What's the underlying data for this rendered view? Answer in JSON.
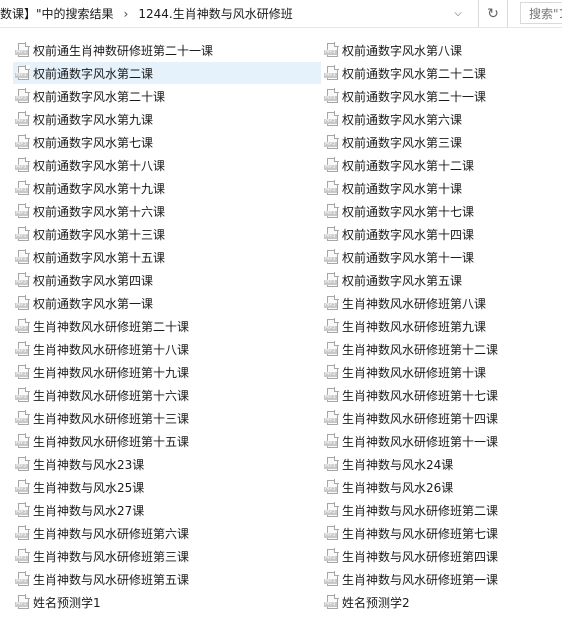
{
  "topbar": {
    "breadcrumb_part1": "数课】\"中的搜索结果",
    "separator": "›",
    "breadcrumb_part2": "1244.生肖神数与风水研修班",
    "dropdown_glyph": "⌵",
    "refresh_glyph": "↻",
    "search_placeholder": "搜索\"1"
  },
  "file_icon_tag": "MP3",
  "files_left": [
    "权前通生肖神数研修班第二十一课",
    "权前通数字风水第二课",
    "权前通数字风水第二十课",
    "权前通数字风水第九课",
    "权前通数字风水第七课",
    "权前通数字风水第十八课",
    "权前通数字风水第十九课",
    "权前通数字风水第十六课",
    "权前通数字风水第十三课",
    "权前通数字风水第十五课",
    "权前通数字风水第四课",
    "权前通数字风水第一课",
    "生肖神数风水研修班第二十课",
    "生肖神数风水研修班第十八课",
    "生肖神数风水研修班第十九课",
    "生肖神数风水研修班第十六课",
    "生肖神数风水研修班第十三课",
    "生肖神数风水研修班第十五课",
    "生肖神数与风水23课",
    "生肖神数与风水25课",
    "生肖神数与风水27课",
    "生肖神数与风水研修班第六课",
    "生肖神数与风水研修班第三课",
    "生肖神数与风水研修班第五课",
    "姓名预测学1"
  ],
  "files_right": [
    "权前通数字风水第八课",
    "权前通数字风水第二十二课",
    "权前通数字风水第二十一课",
    "权前通数字风水第六课",
    "权前通数字风水第三课",
    "权前通数字风水第十二课",
    "权前通数字风水第十课",
    "权前通数字风水第十七课",
    "权前通数字风水第十四课",
    "权前通数字风水第十一课",
    "权前通数字风水第五课",
    "生肖神数风水研修班第八课",
    "生肖神数风水研修班第九课",
    "生肖神数风水研修班第十二课",
    "生肖神数风水研修班第十课",
    "生肖神数风水研修班第十七课",
    "生肖神数风水研修班第十四课",
    "生肖神数风水研修班第十一课",
    "生肖神数与风水24课",
    "生肖神数与风水26课",
    "生肖神数与风水研修班第二课",
    "生肖神数与风水研修班第七课",
    "生肖神数与风水研修班第四课",
    "生肖神数与风水研修班第一课",
    "姓名预测学2"
  ],
  "selected": {
    "column": "left",
    "index": 1
  },
  "colors": {
    "selection": "#e5f1fb",
    "icon_border": "#a6a6a6"
  }
}
